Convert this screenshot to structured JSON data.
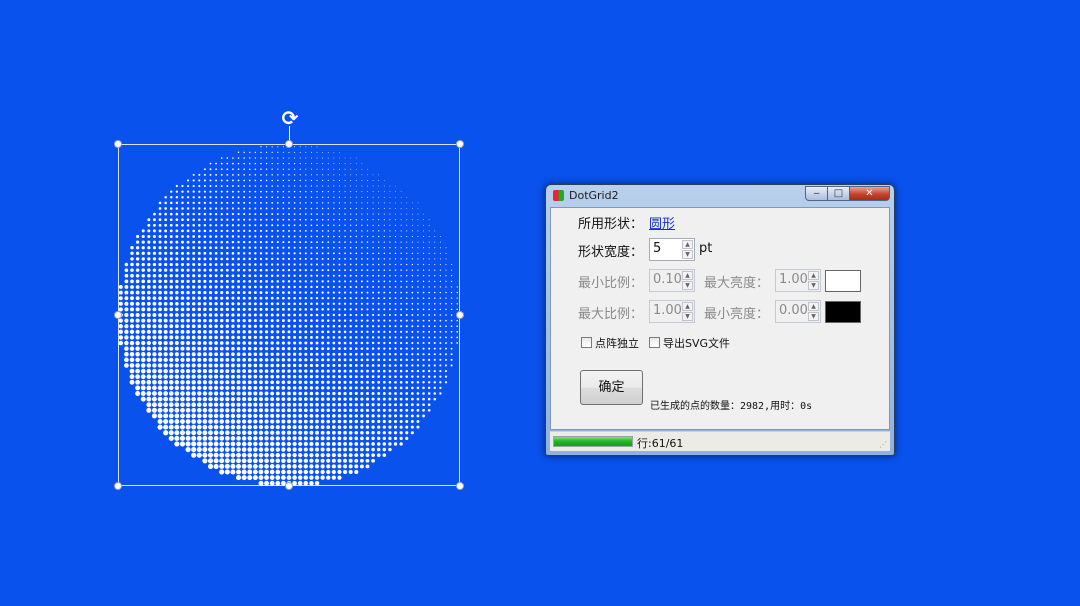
{
  "canvas": {
    "background": "#0a52ee",
    "dot_color": "#ffffff",
    "rotate_glyph": "⟳"
  },
  "window": {
    "title": "DotGrid2",
    "icon": "app-icon",
    "minimize": "‒",
    "maximize": "□",
    "close": "✕"
  },
  "form": {
    "shape_label": "所用形状：",
    "shape_value": "圆形",
    "width_label": "形状宽度：",
    "width_value": "5",
    "width_unit": "pt",
    "min_scale_label": "最小比例：",
    "min_scale_value": "0.10",
    "max_scale_label": "最大比例：",
    "max_scale_value": "1.00",
    "max_brightness_label": "最大亮度：",
    "max_brightness_value": "1.00",
    "max_brightness_color": "#ffffff",
    "min_brightness_label": "最小亮度：",
    "min_brightness_value": "0.00",
    "min_brightness_color": "#000000",
    "independent_label": "点阵独立",
    "export_svg_label": "导出SVG文件",
    "ok_label": "确定",
    "result_text": "已生成的点的数量：2982,用时：0s"
  },
  "status": {
    "progress_fraction": 1.0,
    "row_text": "行:61/61"
  }
}
